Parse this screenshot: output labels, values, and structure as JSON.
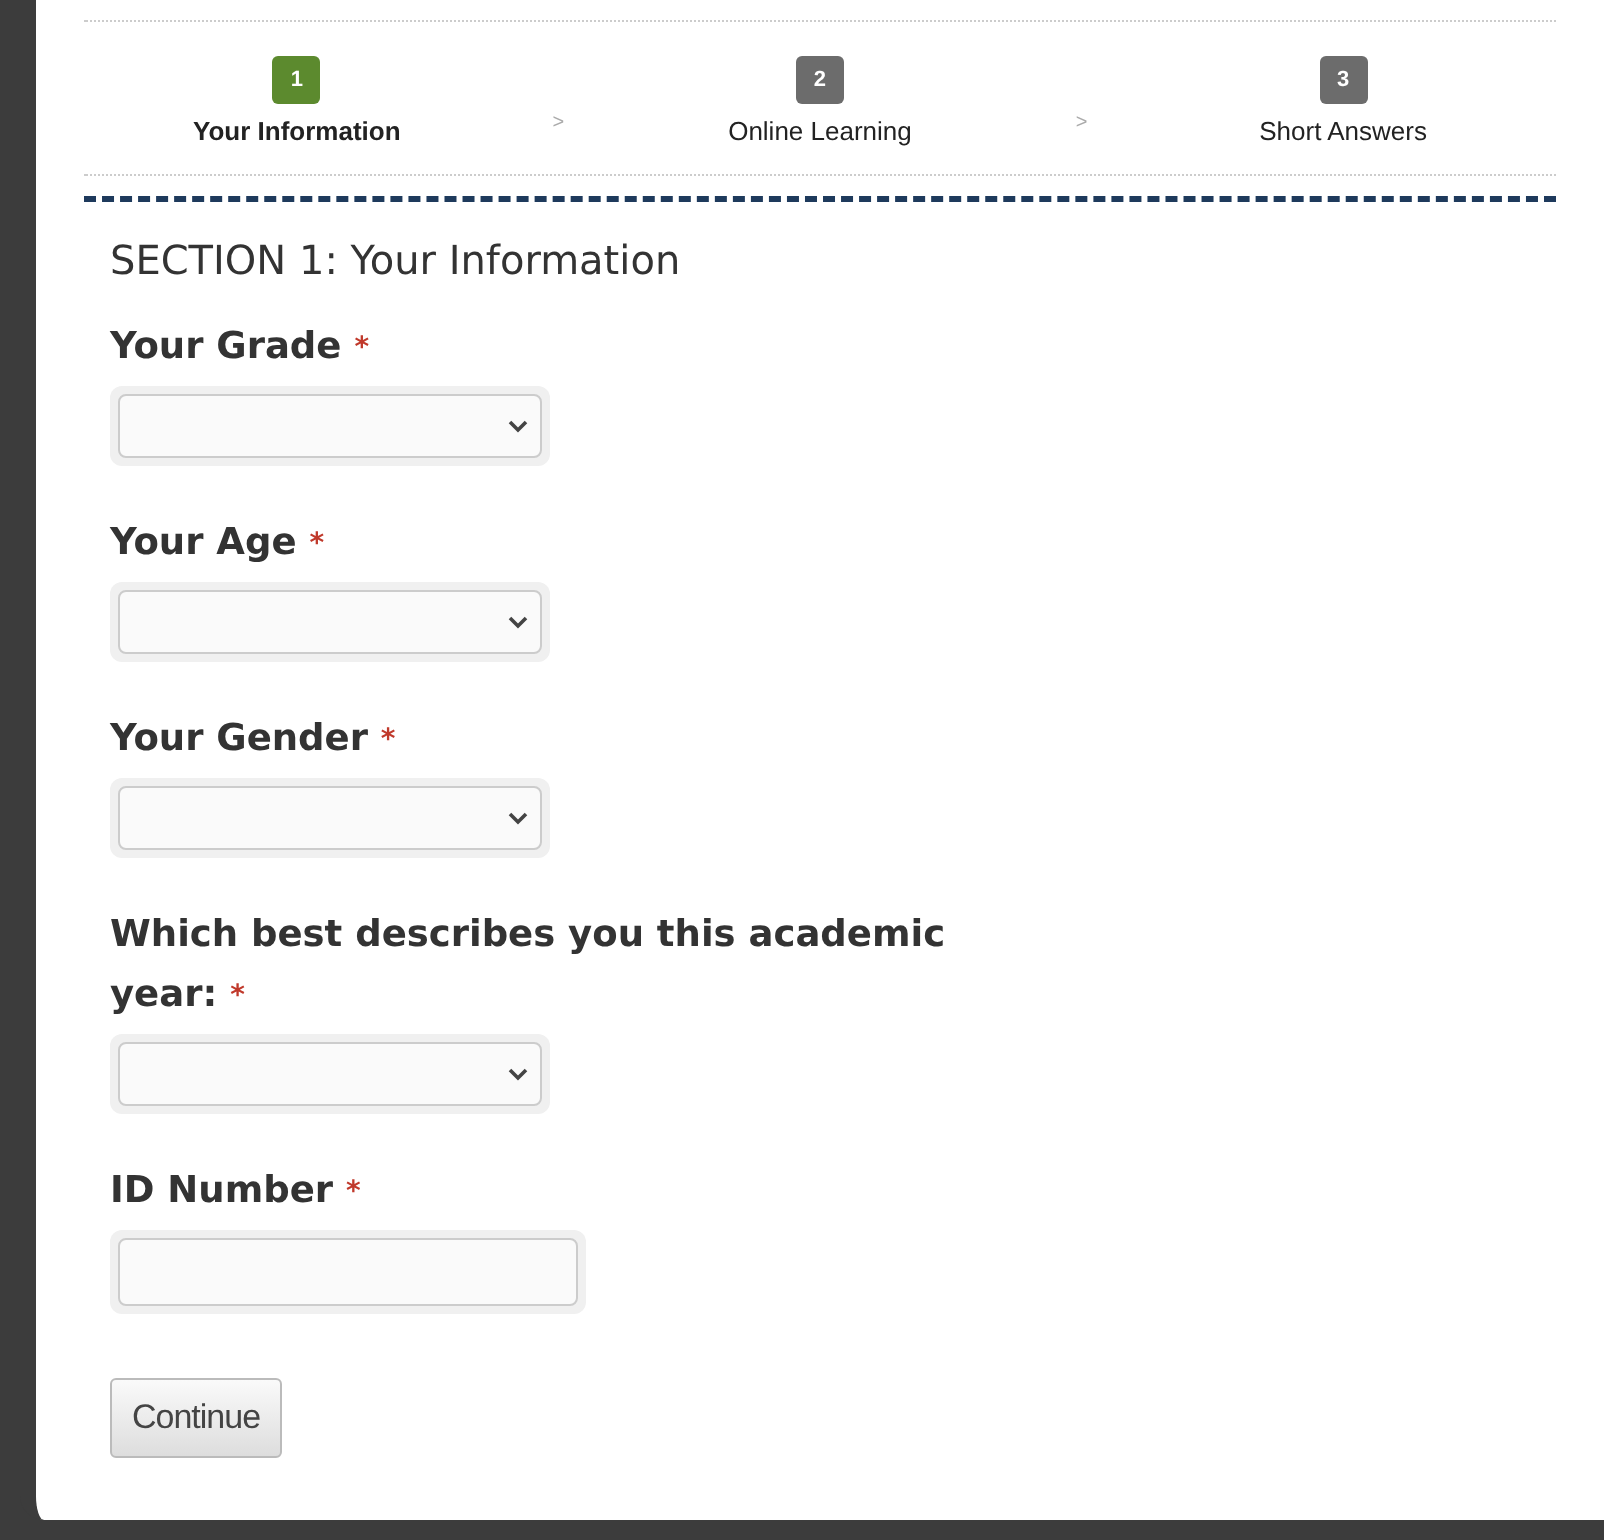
{
  "steps": [
    {
      "number": "1",
      "label": "Your Information",
      "selected": true
    },
    {
      "number": "2",
      "label": "Online Learning",
      "selected": false
    },
    {
      "number": "3",
      "label": "Short Answers",
      "selected": false
    }
  ],
  "step_separator": ">",
  "section_title": "SECTION 1: Your Information",
  "fields": [
    {
      "kind": "select",
      "label": "Your Grade",
      "required_mark": "*"
    },
    {
      "kind": "select",
      "label": "Your Age",
      "required_mark": "*"
    },
    {
      "kind": "select",
      "label": "Your Gender",
      "required_mark": "*"
    },
    {
      "kind": "select",
      "label": "Which best describes you this academic year:",
      "required_mark": "*"
    },
    {
      "kind": "text",
      "label": "ID Number",
      "required_mark": "*"
    }
  ],
  "buttons": [
    {
      "label": "Continue"
    }
  ]
}
